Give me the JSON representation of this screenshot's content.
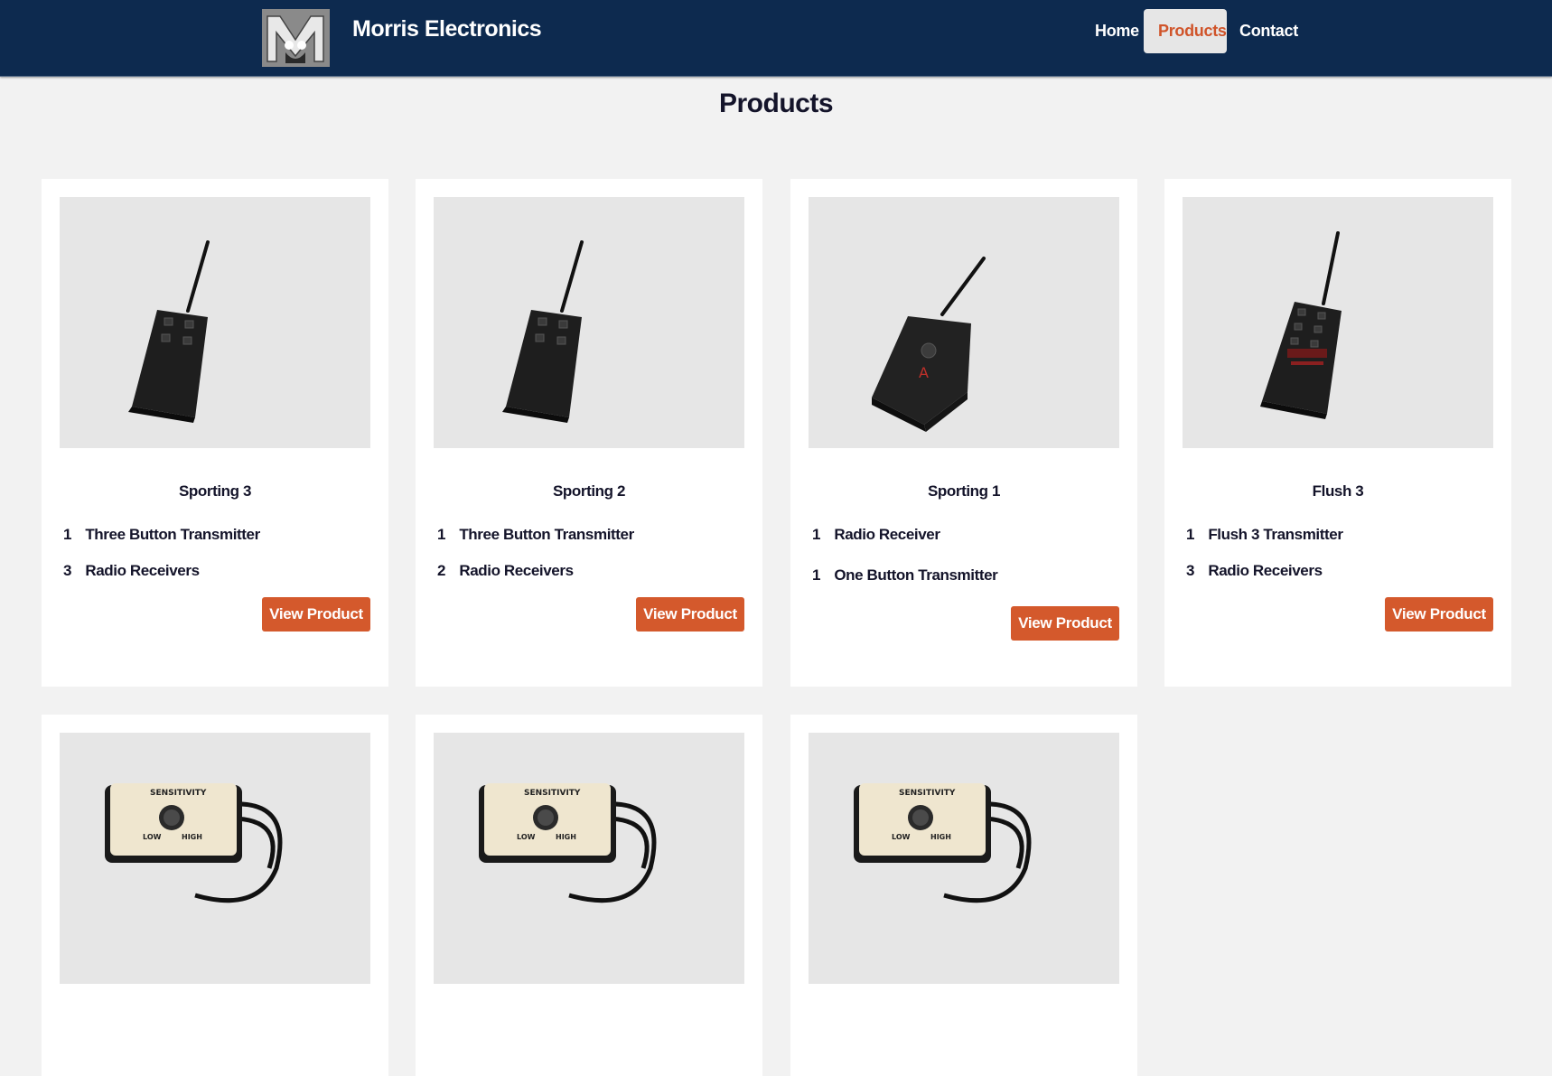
{
  "header": {
    "brand": "Morris Electronics",
    "nav": [
      {
        "label": "Home"
      },
      {
        "label": "Products",
        "active": true
      },
      {
        "label": "Contact"
      }
    ]
  },
  "page": {
    "title": "Products"
  },
  "products": [
    {
      "title": "Sporting 3",
      "image": "three-button-transmitter",
      "items": [
        {
          "qty": "1",
          "label": "Three Button Transmitter"
        },
        {
          "qty": "3",
          "label": "Radio Receivers"
        }
      ],
      "button": "View Product"
    },
    {
      "title": "Sporting 2",
      "image": "three-button-transmitter",
      "items": [
        {
          "qty": "1",
          "label": "Three Button Transmitter"
        },
        {
          "qty": "2",
          "label": "Radio Receivers"
        }
      ],
      "button": "View Product"
    },
    {
      "title": "Sporting 1",
      "image": "one-button-receiver",
      "items": [
        {
          "qty": "1",
          "label": "Radio Receiver"
        },
        {
          "qty": "1",
          "label": "One Button Transmitter"
        }
      ],
      "button": "View Product"
    },
    {
      "title": "Flush 3",
      "image": "flush-transmitter",
      "items": [
        {
          "qty": "1",
          "label": "Flush 3 Transmitter"
        },
        {
          "qty": "3",
          "label": "Radio Receivers"
        }
      ],
      "button": "View Product"
    },
    {
      "image": "sensitivity-receiver",
      "device_label": {
        "sensitivity": "SENSITIVITY",
        "low": "LOW",
        "high": "HIGH"
      }
    },
    {
      "image": "sensitivity-receiver",
      "device_label": {
        "sensitivity": "SENSITIVITY",
        "low": "LOW",
        "high": "HIGH"
      }
    },
    {
      "image": "sensitivity-receiver",
      "device_label": {
        "sensitivity": "SENSITIVITY",
        "low": "LOW",
        "high": "HIGH"
      }
    }
  ],
  "colors": {
    "navbar": "#0d2a4f",
    "accent": "#d4592c",
    "background": "#f2f2f2"
  }
}
